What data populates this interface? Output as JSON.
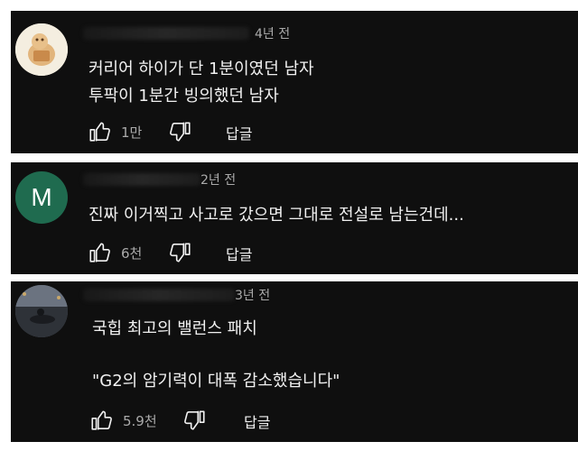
{
  "comments": [
    {
      "avatar": {
        "type": "image",
        "description_icon": "figure-avatar",
        "bg": "#f3ecd9"
      },
      "time": "4년 전",
      "lines": [
        "커리어 하이가 단 1분이였던 남자",
        "투팍이 1분간 빙의했던 남자"
      ],
      "likes": "1만",
      "reply_label": "답글"
    },
    {
      "avatar": {
        "type": "letter",
        "letter": "M",
        "bg": "#1f6b4f"
      },
      "time": "2년 전",
      "lines": [
        "진짜 이거찍고 사고로 갔으면 그대로 전설로 남는건데..."
      ],
      "likes": "6천",
      "reply_label": "답글"
    },
    {
      "avatar": {
        "type": "image",
        "description_icon": "night-scene-avatar",
        "bg": "#3b4048"
      },
      "time": "3년 전",
      "lines": [
        "국힙 최고의 밸런스 패치",
        "\"G2의 암기력이 대폭 감소했습니다\""
      ],
      "likes": "5.9천",
      "reply_label": "답글"
    }
  ]
}
